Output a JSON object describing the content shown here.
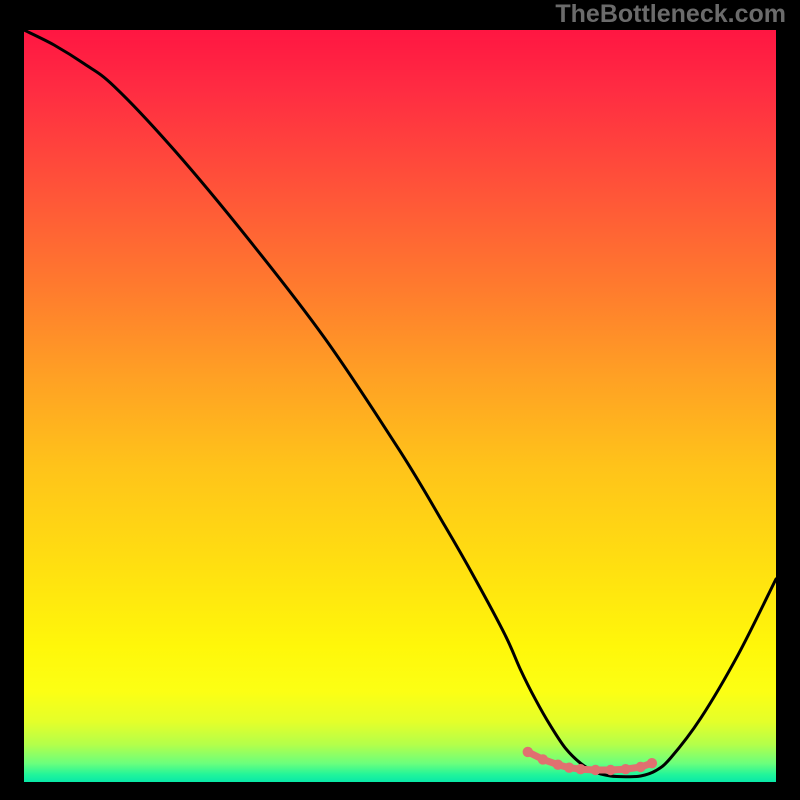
{
  "watermark": "TheBottleneck.com",
  "chart_data": {
    "type": "line",
    "title": "",
    "xlabel": "",
    "ylabel": "",
    "xlim": [
      0,
      100
    ],
    "ylim": [
      0,
      100
    ],
    "series": [
      {
        "name": "bottleneck-curve",
        "x": [
          0,
          4,
          8,
          12,
          20,
          30,
          40,
          50,
          56,
          60,
          64,
          66,
          68,
          70,
          72,
          74,
          76,
          78,
          80,
          82,
          84,
          86,
          90,
          95,
          100
        ],
        "values": [
          100,
          98,
          95.5,
          92.5,
          84,
          72,
          59,
          44,
          34,
          27,
          19.5,
          15,
          11,
          7.5,
          4.5,
          2.5,
          1.3,
          0.8,
          0.7,
          0.8,
          1.5,
          3.2,
          8.5,
          17,
          27
        ]
      }
    ],
    "valley_markers": {
      "x": [
        67,
        69,
        71,
        72.5,
        74,
        76,
        78,
        80,
        82,
        83.5
      ],
      "values": [
        4.0,
        3.0,
        2.3,
        1.9,
        1.7,
        1.6,
        1.6,
        1.7,
        2.0,
        2.5
      ]
    },
    "gradient_stops": [
      {
        "pos": 0.0,
        "color": "#ff1642"
      },
      {
        "pos": 0.08,
        "color": "#ff2c42"
      },
      {
        "pos": 0.22,
        "color": "#ff5638"
      },
      {
        "pos": 0.34,
        "color": "#ff7a2e"
      },
      {
        "pos": 0.46,
        "color": "#ffa024"
      },
      {
        "pos": 0.58,
        "color": "#ffc31a"
      },
      {
        "pos": 0.72,
        "color": "#ffe110"
      },
      {
        "pos": 0.82,
        "color": "#fff70a"
      },
      {
        "pos": 0.88,
        "color": "#fcff14"
      },
      {
        "pos": 0.92,
        "color": "#e4ff2a"
      },
      {
        "pos": 0.95,
        "color": "#b4ff4a"
      },
      {
        "pos": 0.975,
        "color": "#6cff7c"
      },
      {
        "pos": 0.99,
        "color": "#22f59a"
      },
      {
        "pos": 1.0,
        "color": "#08e8a8"
      }
    ]
  }
}
